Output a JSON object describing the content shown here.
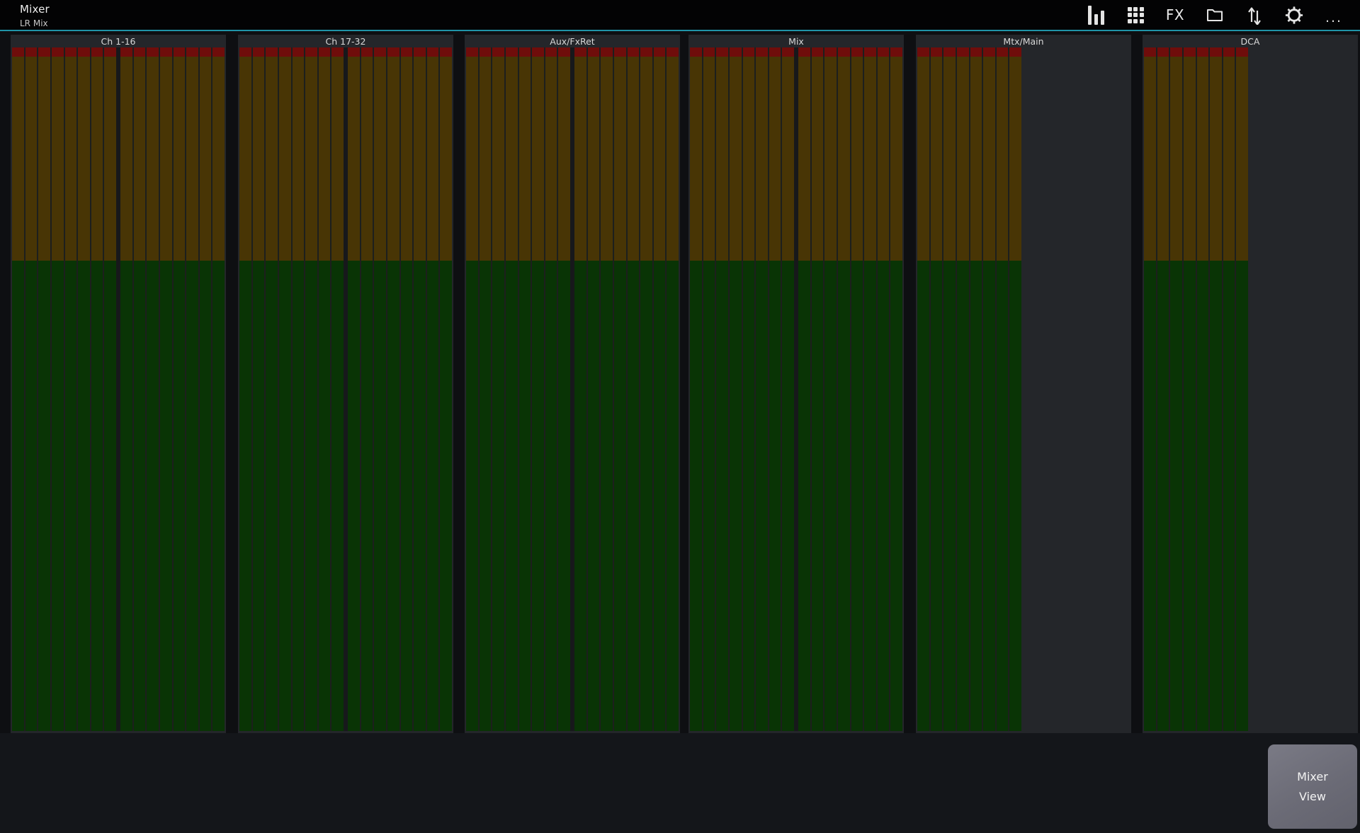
{
  "topbar": {
    "title": "Mixer",
    "subtitle": "LR Mix",
    "icons": [
      {
        "name": "meters-icon"
      },
      {
        "name": "channel-grid-icon"
      },
      {
        "name": "fx-icon",
        "label": "FX"
      },
      {
        "name": "folder-icon"
      },
      {
        "name": "swap-vertical-icon"
      },
      {
        "name": "settings-gear-icon"
      },
      {
        "name": "overflow-menu-icon",
        "label": "..."
      }
    ]
  },
  "mixer_groups": [
    {
      "label": "Ch 1-16",
      "strip_count": 16,
      "split": true
    },
    {
      "label": "Ch 17-32",
      "strip_count": 16,
      "split": true
    },
    {
      "label": "Aux/FxRet",
      "strip_count": 16,
      "split": true
    },
    {
      "label": "Mix",
      "strip_count": 16,
      "split": true
    },
    {
      "label": "Mtx/Main",
      "strip_count": 8,
      "split": false
    },
    {
      "label": "DCA",
      "strip_count": 8,
      "split": false
    }
  ],
  "meter_legend": {
    "clip_cap_color": "#6f0d0b",
    "upper_section_color": "#483505",
    "lower_section_color": "#093405"
  },
  "colors": {
    "accent_teal": "#1f94a8",
    "panel_background": "#24262a",
    "strip_separator": "#1d1f1d",
    "topbar_background": "#030304",
    "page_background": "#0e0f12",
    "bottom_background": "#14161a",
    "button_gray": "#6f6f7a"
  },
  "bottom": {
    "mixer_view_button": {
      "line1": "Mixer",
      "line2": "View"
    }
  }
}
